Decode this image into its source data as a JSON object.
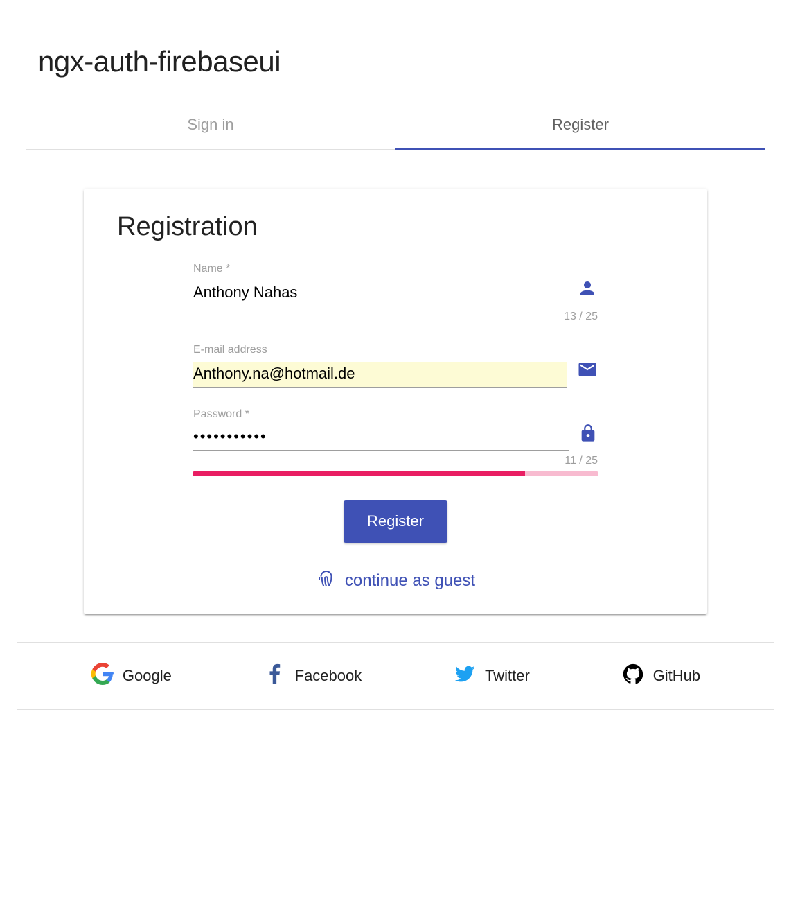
{
  "header": {
    "title": "ngx-auth-firebaseui"
  },
  "tabs": {
    "signin_label": "Sign in",
    "register_label": "Register"
  },
  "form": {
    "heading": "Registration",
    "name_label": "Name *",
    "name_value": "Anthony Nahas",
    "name_counter": "13 / 25",
    "email_label": "E-mail address",
    "email_value": "Anthony.na@hotmail.de",
    "password_label": "Password *",
    "password_value": "•••••••••••",
    "password_counter": "11 / 25",
    "password_strength_percent": 82,
    "submit_label": "Register",
    "guest_label": "continue as guest"
  },
  "providers": {
    "google": "Google",
    "facebook": "Facebook",
    "twitter": "Twitter",
    "github": "GitHub"
  },
  "colors": {
    "primary": "#3f51b5",
    "accent": "#e91e63"
  }
}
